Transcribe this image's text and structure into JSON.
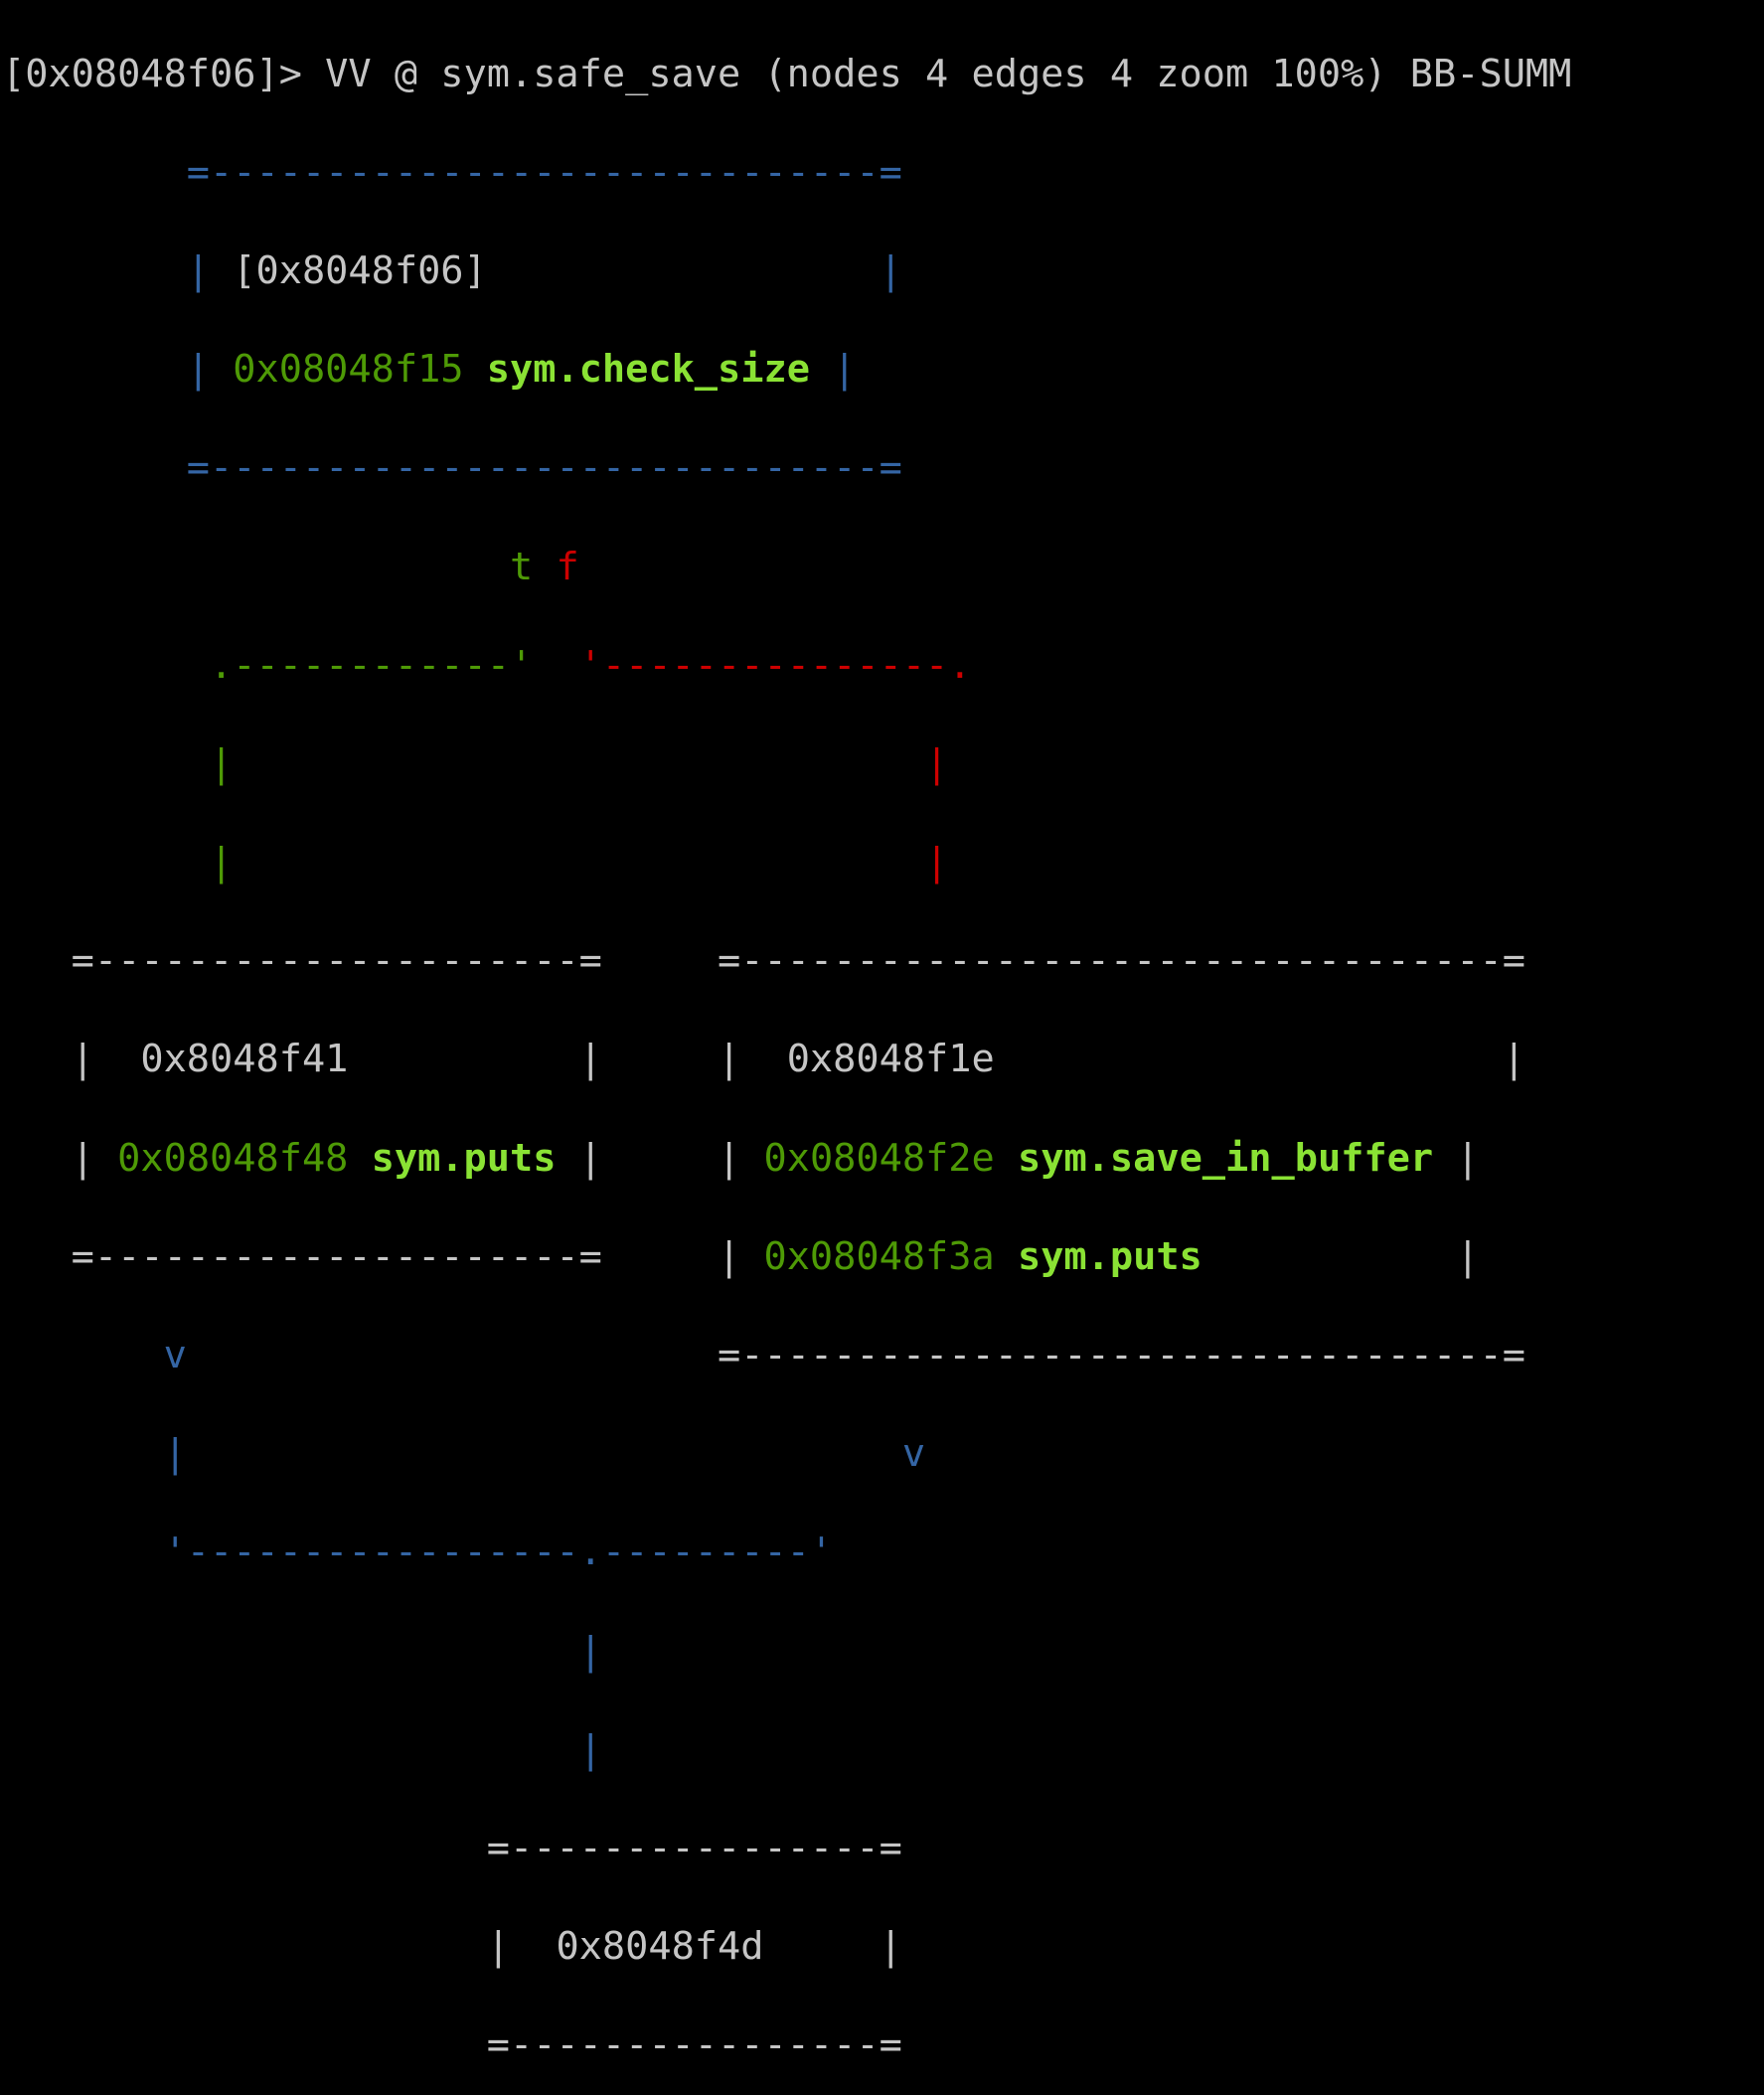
{
  "colors": {
    "background": "#000000",
    "text": "#c5c5c5",
    "true_edge": "#4e9a06",
    "false_edge": "#cc0000",
    "unconditional_edge": "#3465a4",
    "function_name": "#8ae234"
  },
  "prompt": {
    "text": "[0x08048f06]> VV @ sym.safe_save (nodes 4 edges 4 zoom 100%) BB-SUMM"
  },
  "nodes": {
    "entry": {
      "addr": "[0x8048f06]",
      "calls": [
        {
          "addr": "0x08048f15",
          "name": "sym.check_size"
        }
      ]
    },
    "true_branch": {
      "addr": "0x8048f41",
      "calls": [
        {
          "addr": "0x08048f48",
          "name": "sym.puts"
        }
      ]
    },
    "false_branch": {
      "addr": "0x8048f1e",
      "calls": [
        {
          "addr": "0x08048f2e",
          "name": "sym.save_in_buffer"
        },
        {
          "addr": "0x08048f3a",
          "name": "sym.puts"
        }
      ]
    },
    "exit": {
      "addr": "0x8048f4d"
    }
  },
  "edges": {
    "true_label": "t",
    "false_label": "f",
    "arrow_glyph": "v"
  }
}
